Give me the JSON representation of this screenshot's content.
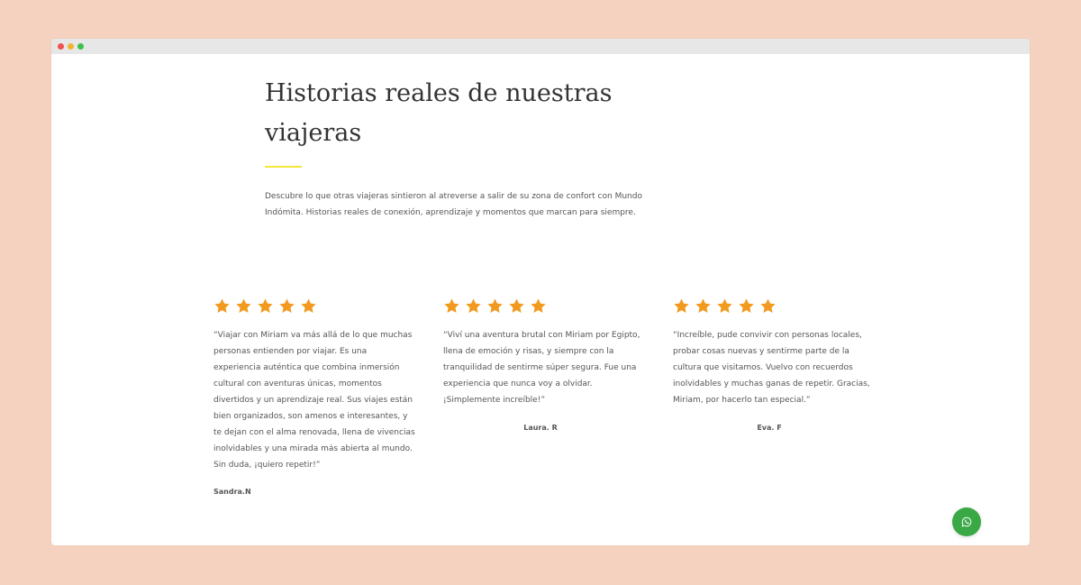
{
  "section": {
    "title": "Historias reales de nuestras viajeras",
    "intro": "Descubre lo que otras viajeras sintieron al atreverse a salir de su zona de confort con Mundo Indómita. Historias reales de conexión, aprendizaje y momentos que marcan para siempre."
  },
  "testimonials": [
    {
      "rating": 5,
      "quote": "“Viajar con Miriam va más allá de lo que muchas personas entienden por viajar. Es una experiencia auténtica que combina inmersión cultural con aventuras únicas, momentos divertidos y un aprendizaje real. Sus viajes están bien organizados, son amenos e interesantes, y te dejan con el alma renovada, llena de vivencias inolvidables y una mirada más abierta al mundo. Sin duda, ¡quiero repetir!”",
      "author": "Sandra.N"
    },
    {
      "rating": 5,
      "quote": "“Viví una aventura brutal con Miriam por Egipto, llena de emoción y risas, y siempre con la tranquilidad de sentirme súper segura. Fue una experiencia que nunca voy a olvidar. ¡Simplemente increíble!”",
      "author": "Laura. R"
    },
    {
      "rating": 5,
      "quote": "“Increíble, pude convivir con personas locales, probar cosas nuevas y sentirme parte de la cultura que visitamos. Vuelvo con recuerdos inolvidables y muchas ganas de repetir. Gracias, Miriam, por hacerlo tan especial.”",
      "author": "Eva. F"
    }
  ],
  "colors": {
    "background": "#f4d2bf",
    "star": "#f29a1f",
    "accent_line": "#f2e83b",
    "whatsapp": "#3aa845"
  },
  "icons": {
    "star": "star-icon",
    "whatsapp": "whatsapp-icon"
  }
}
